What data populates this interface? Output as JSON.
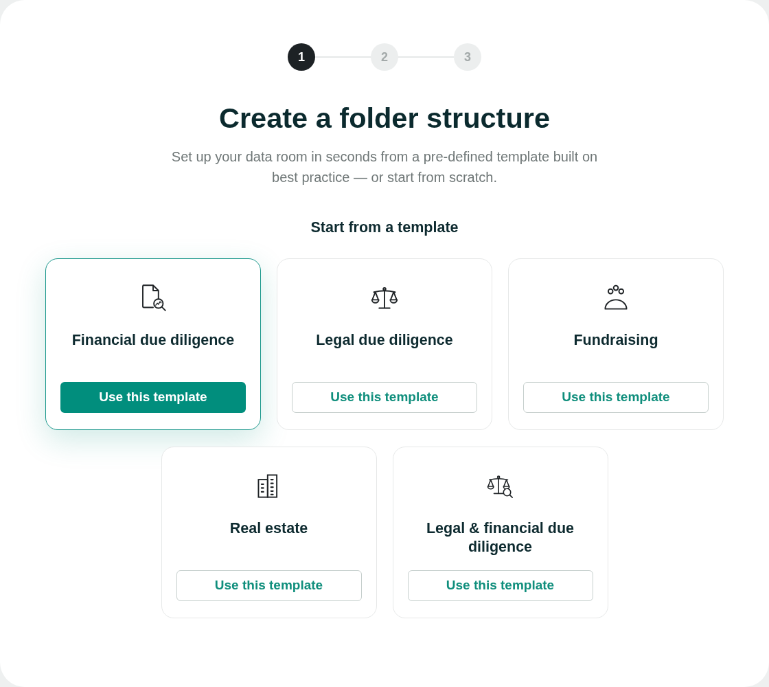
{
  "steps": [
    {
      "label": "1",
      "selected": true
    },
    {
      "label": "2",
      "selected": false
    },
    {
      "label": "3",
      "selected": false
    }
  ],
  "title": "Create a folder structure",
  "subtitle": "Set up your data room in seconds from a pre-defined template built on best practice — or start from scratch.",
  "section_title": "Start from a template",
  "templates": [
    {
      "kind": "financial",
      "title": "Financial due diligence",
      "button": "Use this template",
      "selected": true
    },
    {
      "kind": "legal",
      "title": "Legal due diligence",
      "button": "Use this template",
      "selected": false
    },
    {
      "kind": "fundraising",
      "title": "Fundraising",
      "button": "Use this template",
      "selected": false
    },
    {
      "kind": "real_estate",
      "title": "Real estate",
      "button": "Use this template",
      "selected": false
    },
    {
      "kind": "legal_financial",
      "title": "Legal & financial due diligence",
      "button": "Use this template",
      "selected": false
    }
  ]
}
